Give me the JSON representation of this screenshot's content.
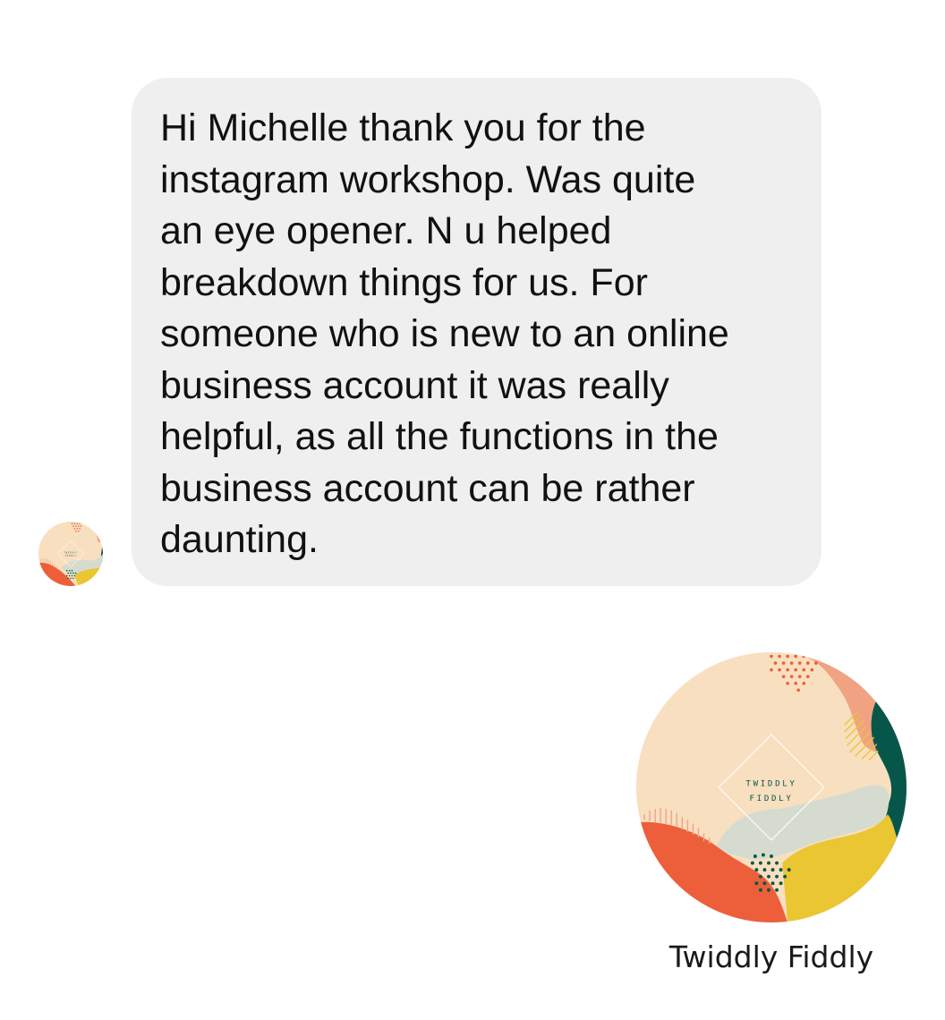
{
  "message": {
    "text": "Hi Michelle thank you for the\ninstagram workshop. Was quite\nan eye opener. N u helped\nbreakdown things for us. For\nsomeone who is new to an online\nbusiness account it was really\nhelpful, as all the functions in the\nbusiness account can be rather\ndaunting."
  },
  "sender": {
    "name": "Twiddly Fiddly",
    "logo_text_line1": "TWIDDLY",
    "logo_text_line2": "FIDDLY",
    "avatar_icon": "twiddly-fiddly-logo"
  },
  "colors": {
    "bubble_background": "#efefef",
    "logo_cream": "#f8dfc0",
    "logo_peach": "#f0a283",
    "logo_dark_green": "#06574a",
    "logo_sage": "#d5dccf",
    "logo_yellow": "#ebc633",
    "logo_orange": "#ec5f3a"
  }
}
